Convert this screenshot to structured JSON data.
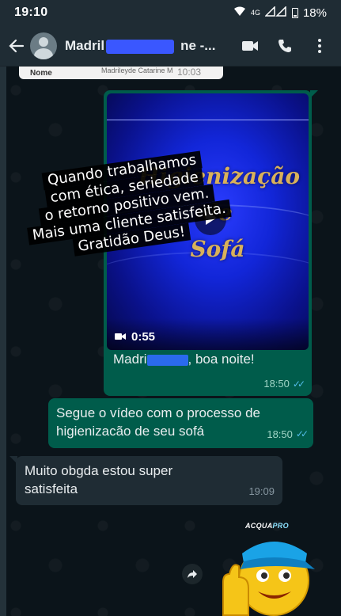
{
  "status_bar": {
    "time": "19:10",
    "network": "4G",
    "battery": "18%"
  },
  "header": {
    "contact_name": "Madril",
    "contact_name_suffix": "ne -..."
  },
  "chat": {
    "previous_card": {
      "label": "Nome",
      "value": "Madrileyde Catarine M",
      "time": "10:03"
    },
    "video_message": {
      "thumbnail_title_line1": "Higienização",
      "thumbnail_title_line2": "de",
      "thumbnail_title_line3": "Sofá",
      "duration": "0:55",
      "caption_prefix": "Madri",
      "caption_suffix": ", boa noite!",
      "time": "18:50"
    },
    "overlay_text": {
      "line1": "Quando trabalhamos",
      "line2": "com ética, seriedade",
      "line3": "o retorno positivo vem.",
      "line4": "Mais uma cliente satisfeita.",
      "line5": "Gratidão Deus!"
    },
    "outgoing_message": {
      "text_line1": "Segue o vídeo com o processo de",
      "text_line2": "higienizacão de seu sofá",
      "time": "18:50"
    },
    "incoming_message": {
      "text_line1": "Muito obgda estou super",
      "text_line2": "satisfeita",
      "time": "19:09"
    },
    "sticker": {
      "brand": "ACQUA",
      "brand_suffix": "PRO"
    }
  },
  "colors": {
    "outgoing_bubble": "#005c4b",
    "incoming_bubble": "#1f2c34",
    "chat_background": "#0b141a",
    "read_ticks": "#53bdeb"
  },
  "icons": {
    "back": "arrow-left-icon",
    "video_call": "video-camera-icon",
    "voice_call": "phone-icon",
    "menu": "more-vertical-icon",
    "play": "play-icon",
    "forward": "forward-icon"
  }
}
